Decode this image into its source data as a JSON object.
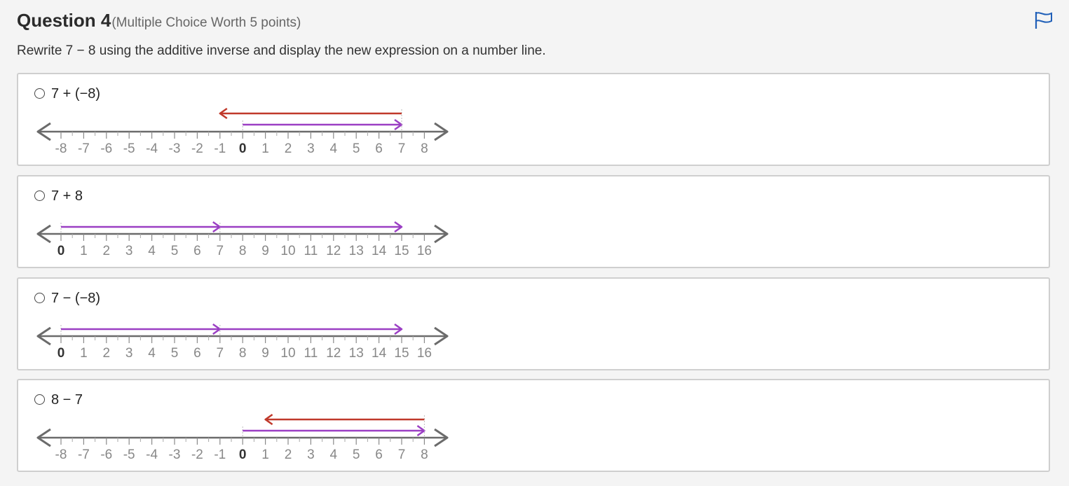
{
  "question": {
    "title": "Question 4",
    "subtitle": "(Multiple Choice Worth 5 points)",
    "prompt": "Rewrite 7 − 8 using the additive inverse and display the new expression on a number line."
  },
  "choices": [
    {
      "label": "7 + (−8)",
      "number_line": {
        "ticks": [
          "-8",
          "-7",
          "-6",
          "-5",
          "-4",
          "-3",
          "-2",
          "-1",
          "0",
          "1",
          "2",
          "3",
          "4",
          "5",
          "6",
          "7",
          "8"
        ],
        "bold_tick": "0",
        "arrows": [
          {
            "from": 0,
            "to": 7,
            "color": "#9b3fc4"
          },
          {
            "from": 7,
            "to": -1,
            "color": "#c0392b"
          }
        ]
      }
    },
    {
      "label": "7 + 8",
      "number_line": {
        "ticks": [
          "0",
          "1",
          "2",
          "3",
          "4",
          "5",
          "6",
          "7",
          "8",
          "9",
          "10",
          "11",
          "12",
          "13",
          "14",
          "15",
          "16"
        ],
        "bold_tick": "0",
        "arrows": [
          {
            "from": 0,
            "to": 7,
            "color": "#9b3fc4"
          },
          {
            "from": 7,
            "to": 15,
            "color": "#9b3fc4"
          }
        ]
      }
    },
    {
      "label": "7 − (−8)",
      "number_line": {
        "ticks": [
          "0",
          "1",
          "2",
          "3",
          "4",
          "5",
          "6",
          "7",
          "8",
          "9",
          "10",
          "11",
          "12",
          "13",
          "14",
          "15",
          "16"
        ],
        "bold_tick": "0",
        "arrows": [
          {
            "from": 0,
            "to": 7,
            "color": "#9b3fc4"
          },
          {
            "from": 7,
            "to": 15,
            "color": "#9b3fc4"
          }
        ]
      }
    },
    {
      "label": "8 − 7",
      "number_line": {
        "ticks": [
          "-8",
          "-7",
          "-6",
          "-5",
          "-4",
          "-3",
          "-2",
          "-1",
          "0",
          "1",
          "2",
          "3",
          "4",
          "5",
          "6",
          "7",
          "8"
        ],
        "bold_tick": "0",
        "arrows": [
          {
            "from": 0,
            "to": 8,
            "color": "#9b3fc4"
          },
          {
            "from": 8,
            "to": 1,
            "color": "#c0392b"
          }
        ]
      }
    }
  ],
  "colors": {
    "axis": "#6b6b6b",
    "flag": "#1f5fb8"
  },
  "icons": {
    "flag": "flag-icon"
  }
}
